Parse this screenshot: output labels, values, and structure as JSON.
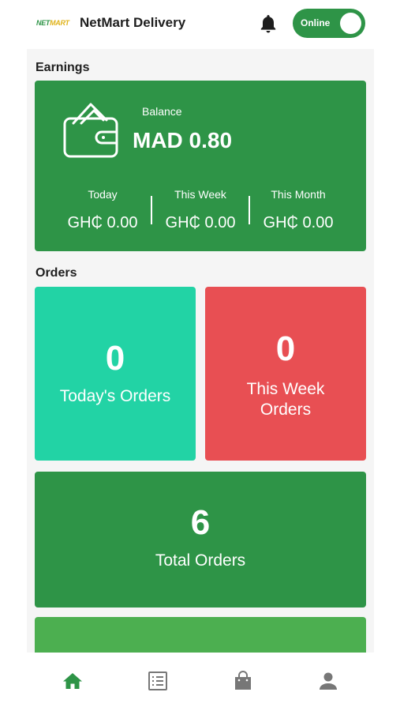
{
  "header": {
    "logo_text_a": "NET",
    "logo_text_b": "MART",
    "title": "NetMart Delivery",
    "status_label": "Online",
    "icons": {
      "notification": "bell-icon"
    }
  },
  "earnings": {
    "section_title": "Earnings",
    "balance_label": "Balance",
    "balance_value": "MAD 0.80",
    "periods": [
      {
        "label": "Today",
        "value": "GH₵ 0.00"
      },
      {
        "label": "This Week",
        "value": "GH₵ 0.00"
      },
      {
        "label": "This Month",
        "value": "GH₵ 0.00"
      }
    ]
  },
  "orders": {
    "section_title": "Orders",
    "today": {
      "count": "0",
      "label": "Today's Orders"
    },
    "week": {
      "count": "0",
      "label_line1": "This Week",
      "label_line2": "Orders"
    },
    "total": {
      "count": "6",
      "label": "Total Orders"
    }
  },
  "bottom_nav": {
    "items": [
      {
        "icon": "home-icon",
        "active": true
      },
      {
        "icon": "list-icon",
        "active": false
      },
      {
        "icon": "shopping-bag-icon",
        "active": false
      },
      {
        "icon": "person-icon",
        "active": false
      }
    ]
  },
  "colors": {
    "primary_green": "#2e9447",
    "teal": "#22d3a5",
    "red": "#e84f53",
    "light_green": "#4caf50"
  }
}
